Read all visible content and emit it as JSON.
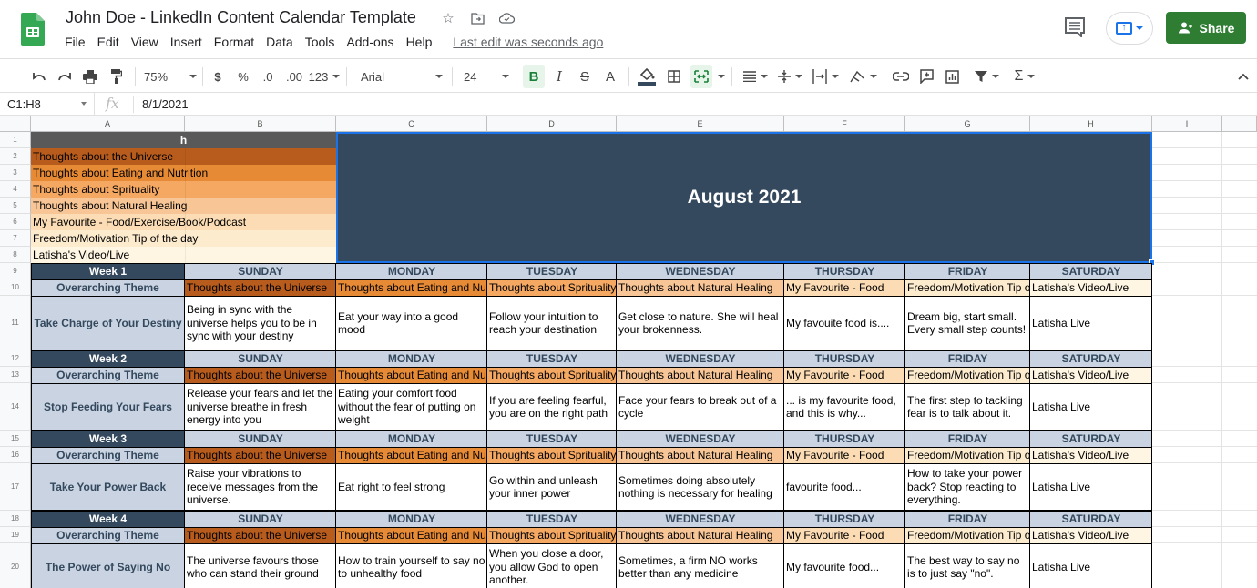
{
  "app": {
    "doc_title": "John Doe - LinkedIn Content Calendar Template",
    "menu": [
      "File",
      "Edit",
      "View",
      "Insert",
      "Format",
      "Data",
      "Tools",
      "Add-ons",
      "Help"
    ],
    "last_edit": "Last edit was seconds ago",
    "share_label": "Share"
  },
  "toolbar": {
    "zoom": "75%",
    "currency": "$",
    "percent": "%",
    "decrease_decimal": ".0",
    "increase_decimal": ".00",
    "more_formats": "123",
    "font": "Arial",
    "font_size": "24",
    "bold": "B",
    "italic": "I",
    "strikethrough": "S",
    "text_color": "A",
    "sum": "Σ",
    "collapse": "^"
  },
  "formula_bar": {
    "name_box": "C1:H8",
    "fx": "fx",
    "value": "8/1/2021"
  },
  "columns": [
    "A",
    "B",
    "C",
    "D",
    "E",
    "F",
    "G",
    "H",
    "I"
  ],
  "rows": [
    "1",
    "2",
    "3",
    "4",
    "5",
    "6",
    "7",
    "8",
    "9",
    "10",
    "11",
    "12",
    "13",
    "14",
    "15",
    "16",
    "17",
    "18",
    "19",
    "20"
  ],
  "legend": {
    "header": "h",
    "items": [
      {
        "label": "Thoughts about the Universe",
        "color": "#b85c1e"
      },
      {
        "label": "Thoughts about Eating and Nutrition",
        "color": "#e78a35"
      },
      {
        "label": "Thoughts about Sprituality",
        "color": "#f4a862"
      },
      {
        "label": "Thoughts about Natural Healing",
        "color": "#f8c696"
      },
      {
        "label": "My Favourite - Food/Exercise/Book/Podcast",
        "color": "#fcdcb4"
      },
      {
        "label": "Freedom/Motivation Tip of the day",
        "color": "#fdebcd"
      },
      {
        "label": "Latisha's Video/Live",
        "color": "#fef5e2"
      }
    ]
  },
  "banner": {
    "title": "August 2021",
    "color": "#34495e"
  },
  "days": [
    "SUNDAY",
    "MONDAY",
    "TUESDAY",
    "WEDNESDAY",
    "THURSDAY",
    "FRIDAY",
    "SATURDAY"
  ],
  "theme_label": "Overarching Theme",
  "themes": [
    "Thoughts about the Universe",
    "Thoughts about Eating and Nu",
    "Thoughts about Sprituality",
    "Thoughts about Natural Healing",
    "My Favourite - Food",
    "Freedom/Motivation Tip o",
    "Latisha's Video/Live"
  ],
  "weeks": [
    {
      "label": "Week 1",
      "title": "Take Charge of Your Destiny",
      "posts": [
        "Being in sync with the universe helps you to be in sync with your destiny",
        "Eat your way into a good mood",
        "Follow your intuition to reach your destination",
        "Get close to nature. She will heal your brokenness.",
        "My favouite food is....",
        "Dream big, start small. Every small step counts!",
        "Latisha Live"
      ]
    },
    {
      "label": "Week 2",
      "title": "Stop Feeding Your Fears",
      "posts": [
        "Release your fears and let the universe breathe in fresh energy into you",
        "Eating your comfort food without the fear of putting on weight",
        "If you are feeling fearful, you are on the right path",
        "Face your fears to break out of a cycle",
        "... is my favourite food, and this is why...",
        "The first step to tackling fear is to talk about it.",
        "Latisha Live"
      ]
    },
    {
      "label": "Week 3",
      "title": "Take Your Power Back",
      "posts": [
        "Raise your vibrations to receive messages from the universe.",
        "Eat right to feel strong",
        "Go within and unleash your inner power",
        "Sometimes doing absolutely nothing is necessary for healing",
        "favourite food...",
        "How to take your power back? Stop reacting to everything.",
        "Latisha Live"
      ]
    },
    {
      "label": "Week 4",
      "title": "The Power of Saying No",
      "posts": [
        "The universe favours those who can stand their ground",
        "How to train yourself to say no to unhealthy food",
        "When you close a door, you allow God to open another.",
        "Sometimes, a firm NO works better than any medicine",
        "My favourite food...",
        "The best way to say no is to just say \"no\".",
        "Latisha Live"
      ]
    }
  ]
}
